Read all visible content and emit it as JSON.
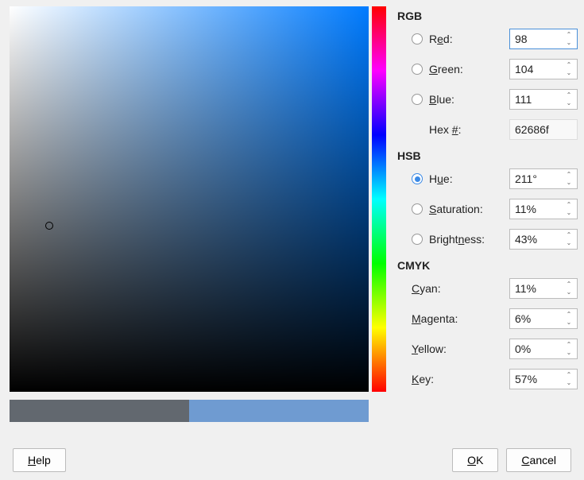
{
  "rgb": {
    "title": "RGB",
    "red_label": "Red:",
    "green_label": "Green:",
    "blue_label": "Blue:",
    "hex_label": "Hex #:",
    "red": "98",
    "green": "104",
    "blue": "111",
    "hex": "62686f"
  },
  "hsb": {
    "title": "HSB",
    "hue_label": "Hue:",
    "sat_label": "Saturation:",
    "bri_label": "Brightness:",
    "hue": "211°",
    "sat": "11%",
    "bri": "43%"
  },
  "cmyk": {
    "title": "CMYK",
    "cyan_label": "Cyan:",
    "magenta_label": "Magenta:",
    "yellow_label": "Yellow:",
    "key_label": "Key:",
    "cyan": "11%",
    "magenta": "6%",
    "yellow": "0%",
    "key": "57%"
  },
  "buttons": {
    "help": "Help",
    "ok": "OK",
    "cancel": "Cancel"
  }
}
